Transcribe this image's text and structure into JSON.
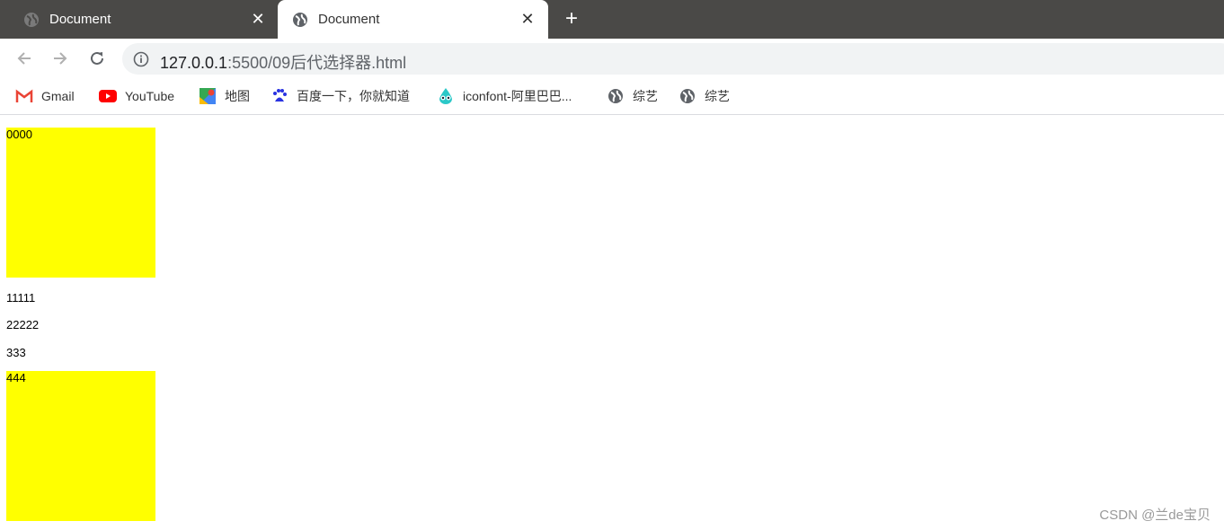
{
  "browser": {
    "tabs": [
      {
        "title": "Document",
        "active": false,
        "favicon": "globe-icon"
      },
      {
        "title": "Document",
        "active": true,
        "favicon": "globe-icon"
      }
    ],
    "close_glyph": "✕",
    "new_tab_glyph": "+",
    "address": {
      "host": "127.0.0.1",
      "path": ":5500/09后代选择器.html"
    },
    "bookmarks": [
      {
        "label": "Gmail",
        "icon": "gmail-icon"
      },
      {
        "label": "YouTube",
        "icon": "youtube-icon"
      },
      {
        "label": "地图",
        "icon": "maps-icon"
      },
      {
        "label": "百度一下，你就知道",
        "icon": "baidu-icon"
      },
      {
        "label": "iconfont-阿里巴巴...",
        "icon": "iconfont-icon"
      },
      {
        "label": "综艺",
        "icon": "globe-icon"
      },
      {
        "label": "综艺",
        "icon": "globe-icon"
      }
    ]
  },
  "page": {
    "items": [
      {
        "text": "0000",
        "highlighted": true
      },
      {
        "text": "11111",
        "highlighted": false
      },
      {
        "text": "22222",
        "highlighted": false
      },
      {
        "text": "333",
        "highlighted": false
      },
      {
        "text": "444",
        "highlighted": true
      }
    ],
    "highlight_color": "#ffff00",
    "watermark": "CSDN @兰de宝贝"
  }
}
